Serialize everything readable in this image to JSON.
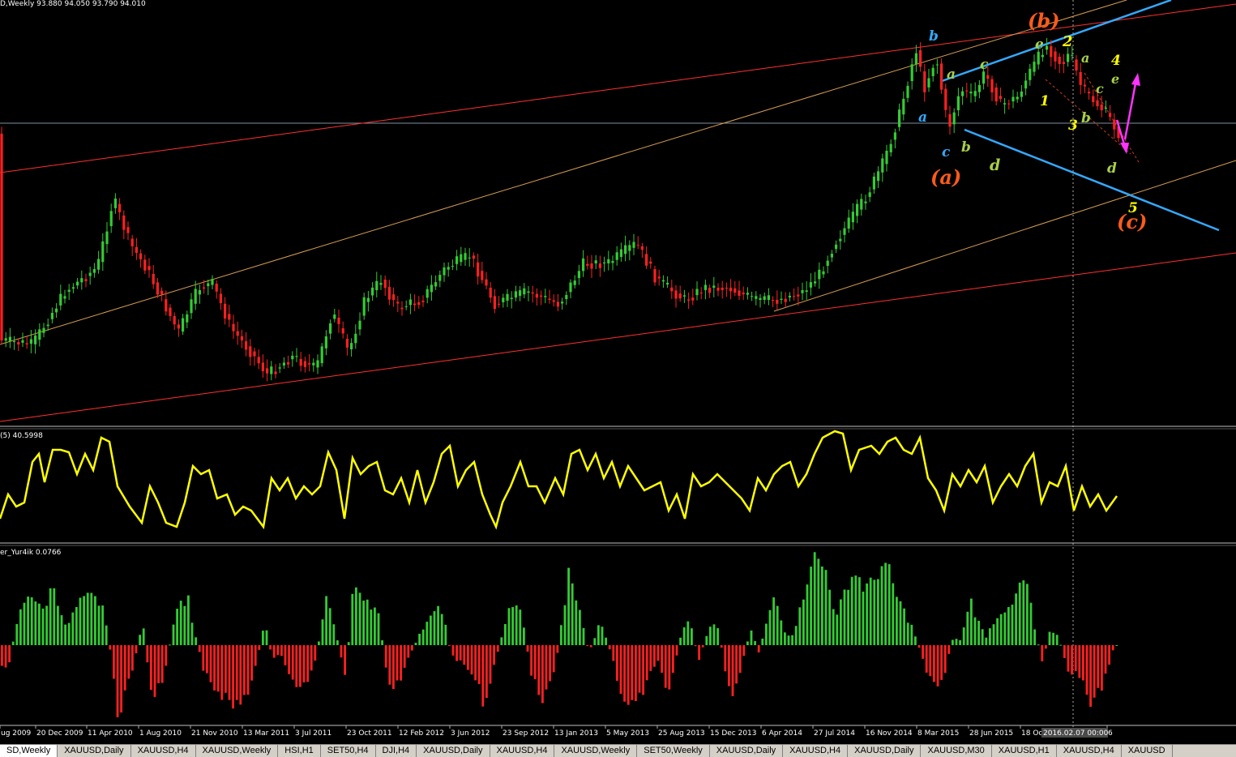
{
  "header": {
    "main_info": "D,Weekly  93.880 94.050 93.790 94.010",
    "ind1_info": "(5) 40.5998",
    "ind2_info": "er_Yur4ik 0.0766"
  },
  "x_axis": {
    "labels": [
      "ug 2009",
      "20 Dec 2009",
      "11 Apr 2010",
      "1 Aug 2010",
      "21 Nov 2010",
      "13 Mar 2011",
      "3 Jul 2011",
      "23 Oct 2011",
      "12 Feb 2012",
      "3 Jun 2012",
      "23 Sep 2012",
      "13 Jan 2013",
      "5 May 2013",
      "25 Aug 2013",
      "15 Dec 2013",
      "6 Apr 2014",
      "27 Jul 2014",
      "16 Nov 2014",
      "8 Mar 2015",
      "28 Jun 2015",
      "18 Oc",
      "6"
    ],
    "cursor_label": "2016.02.07 00:00"
  },
  "colors": {
    "bull": "#33cc33",
    "bear": "#ff2020",
    "osc": "#ffff00",
    "red_line": "#ff3030",
    "orange_line": "#ffd080",
    "blue_line": "#33aaff",
    "magenta_arrow": "#ff33ff"
  },
  "wave_labels": [
    {
      "text": "(b)",
      "color": "#ff5a1a"
    },
    {
      "text": "b",
      "color": "#33aaff"
    },
    {
      "text": "a",
      "color": "#33aaff"
    },
    {
      "text": "c",
      "color": "#33aaff"
    },
    {
      "text": "(a)",
      "color": "#ff5a1a"
    },
    {
      "text": "a",
      "color": "#a8d048"
    },
    {
      "text": "b",
      "color": "#a8d048"
    },
    {
      "text": "c",
      "color": "#a8d048"
    },
    {
      "text": "d",
      "color": "#a8d048"
    },
    {
      "text": "e",
      "color": "#a8d048"
    },
    {
      "text": "1",
      "color": "#ffff00"
    },
    {
      "text": "2",
      "color": "#ffff00"
    },
    {
      "text": "3",
      "color": "#ffff00"
    },
    {
      "text": "4",
      "color": "#ffff00"
    },
    {
      "text": "5",
      "color": "#ffff00"
    },
    {
      "text": "(c)",
      "color": "#ff5a1a"
    },
    {
      "text": "a",
      "color": "#a8d048"
    },
    {
      "text": "b",
      "color": "#a8d048"
    },
    {
      "text": "c",
      "color": "#a8d048"
    },
    {
      "text": "d",
      "color": "#a8d048"
    },
    {
      "text": "e",
      "color": "#a8d048"
    }
  ],
  "tabs": [
    {
      "label": "SD,Weekly",
      "active": true
    },
    {
      "label": "XAUUSD,Daily"
    },
    {
      "label": "XAUUSD,H4"
    },
    {
      "label": "XAUUSD,Weekly"
    },
    {
      "label": "HSI,H1"
    },
    {
      "label": "SET50,H4"
    },
    {
      "label": "DJI,H4"
    },
    {
      "label": "XAUUSD,Daily"
    },
    {
      "label": "XAUUSD,H4"
    },
    {
      "label": "XAUUSD,Weekly"
    },
    {
      "label": "SET50,Weekly"
    },
    {
      "label": "XAUUSD,Daily"
    },
    {
      "label": "XAUUSD,H4"
    },
    {
      "label": "XAUUSD,Daily"
    },
    {
      "label": "XAUUSD,M30"
    },
    {
      "label": "XAUUSD,H1"
    },
    {
      "label": "XAUUSD,H4"
    },
    {
      "label": "XAUUSD"
    }
  ]
}
